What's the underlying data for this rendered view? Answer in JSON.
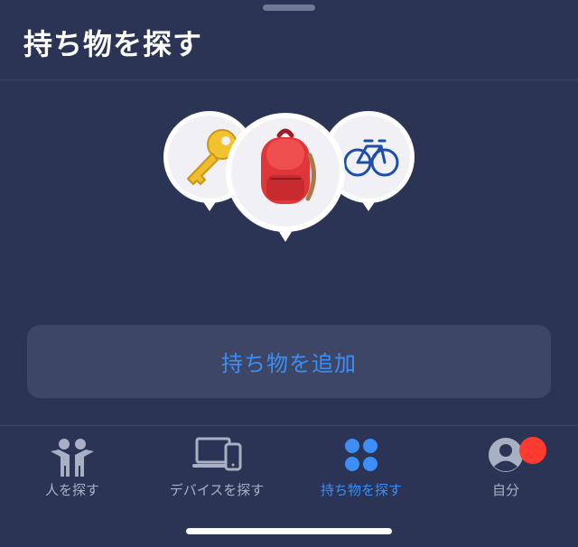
{
  "screen": {
    "title": "持ち物を探す"
  },
  "items_illustration": {
    "pins": [
      {
        "name": "key",
        "icon": "key-icon"
      },
      {
        "name": "backpack",
        "icon": "backpack-icon"
      },
      {
        "name": "bicycle",
        "icon": "bicycle-icon"
      }
    ]
  },
  "add_item": {
    "label": "持ち物を追加"
  },
  "tabbar": {
    "tabs": [
      {
        "label": "人を探す",
        "icon": "people-icon",
        "active": false
      },
      {
        "label": "デバイスを探す",
        "icon": "devices-icon",
        "active": false
      },
      {
        "label": "持ち物を探す",
        "icon": "items-icon",
        "active": true
      },
      {
        "label": "自分",
        "icon": "me-icon",
        "active": false
      }
    ]
  },
  "colors": {
    "background": "#2b3454",
    "accent": "#3c8ef6",
    "button_bg": "#3d4665",
    "badge": "#ff3b30",
    "inactive": "#aab0c3"
  }
}
